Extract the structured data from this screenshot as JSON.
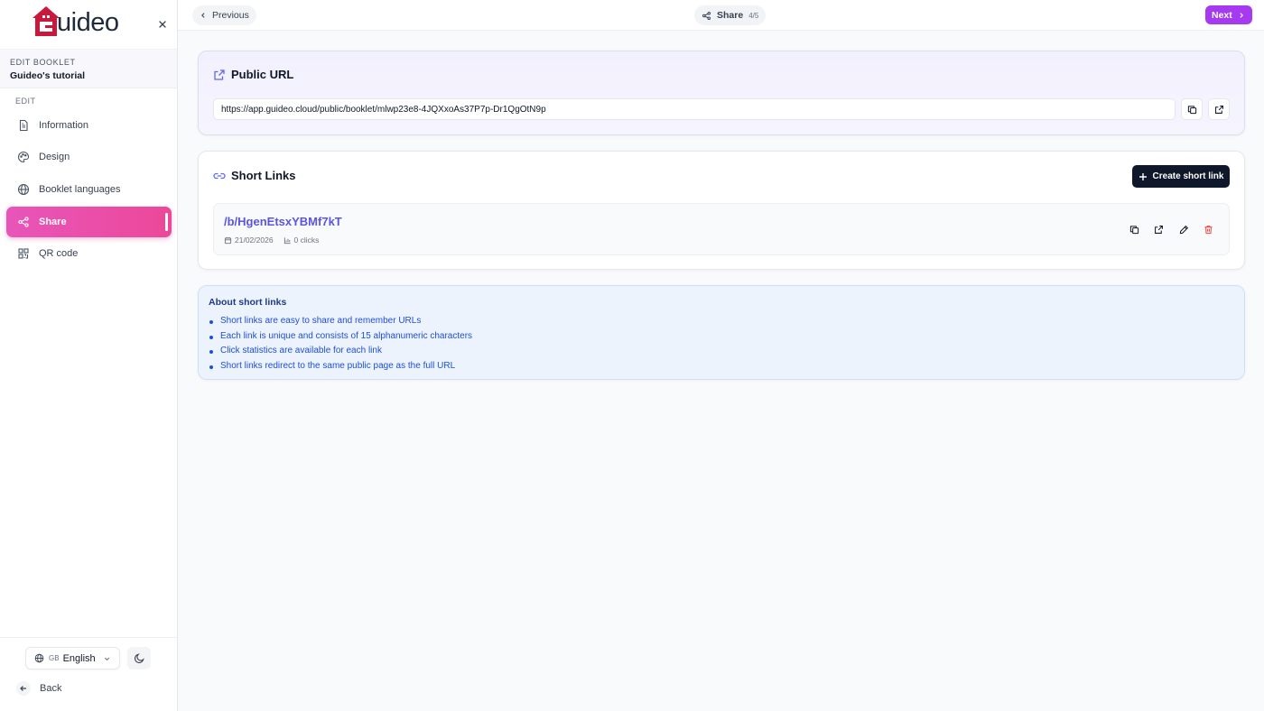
{
  "colors": {
    "accent_pink": "#ec4899",
    "accent_purple": "#a53af0",
    "link_indigo": "#5b55e0",
    "info_blue": "#1d4ed8",
    "logo_red": "#c8193c"
  },
  "sidebar": {
    "logo": {
      "text": "uideo"
    },
    "edit_kicker": "EDIT BOOKLET",
    "booklet_title": "Guideo's tutorial",
    "section_label": "EDIT",
    "items": [
      {
        "label": "Information",
        "icon": "document-icon",
        "active": false
      },
      {
        "label": "Design",
        "icon": "palette-icon",
        "active": false
      },
      {
        "label": "Booklet languages",
        "icon": "globe-icon",
        "active": false
      },
      {
        "label": "Share",
        "icon": "share-icon",
        "active": true
      },
      {
        "label": "QR code",
        "icon": "qr-code-icon",
        "active": false
      }
    ],
    "language": {
      "flag": "GB",
      "name": "English"
    },
    "back_label": "Back"
  },
  "topbar": {
    "previous_label": "Previous",
    "step_label": "Share",
    "step_counter": "4/5",
    "next_label": "Next"
  },
  "public_url": {
    "title": "Public URL",
    "value": "https://app.guideo.cloud/public/booklet/mlwp23e8-4JQXxoAs37P7p-Dr1QgOtN9p"
  },
  "short_links": {
    "title": "Short Links",
    "create_label": "Create short link",
    "items": [
      {
        "slug": "/b/HgenEtsxYBMf7kT",
        "date": "21/02/2026",
        "clicks": "0 clicks"
      }
    ]
  },
  "about": {
    "title": "About short links",
    "points": [
      "Short links are easy to share and remember URLs",
      "Each link is unique and consists of 15 alphanumeric characters",
      "Click statistics are available for each link",
      "Short links redirect to the same public page as the full URL"
    ]
  }
}
